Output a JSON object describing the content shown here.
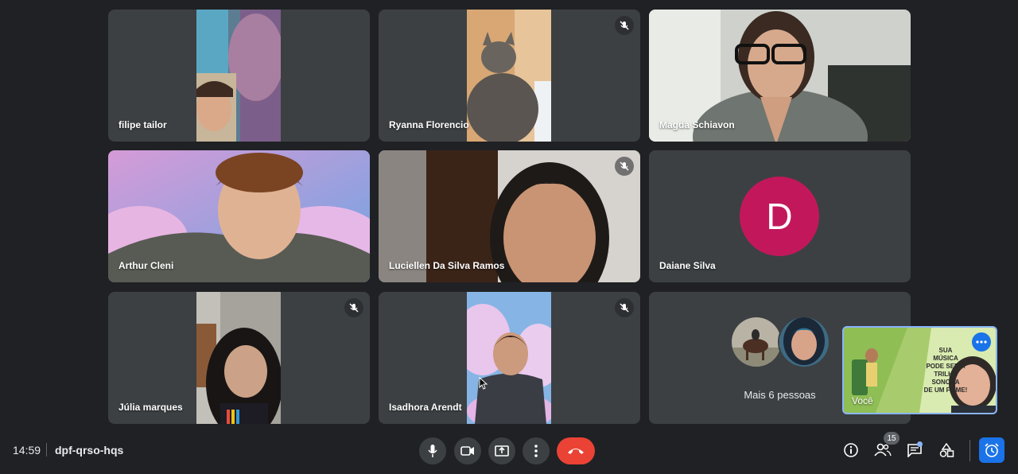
{
  "participants": [
    {
      "name": "filipe tailor",
      "muted": false
    },
    {
      "name": "Ryanna Florencio",
      "muted": true
    },
    {
      "name": "Magda Schiavon",
      "muted": false
    },
    {
      "name": "Arthur Cleni",
      "muted": false
    },
    {
      "name": "Luciellen Da Silva Ramos",
      "muted": true
    },
    {
      "name": "Daiane Silva",
      "muted": false,
      "avatar_letter": "D",
      "avatar_color": "#c2185b"
    },
    {
      "name": "Júlia marques",
      "muted": true
    },
    {
      "name": "Isadhora Arendt",
      "muted": true
    }
  ],
  "overflow_tile": {
    "label": "Mais 6 pessoas"
  },
  "self_view": {
    "name": "Você",
    "slide_text": [
      "SUA",
      "MÚSICA",
      "PODE SER A",
      "TRILHA SONORA",
      "DE UM FILME!"
    ]
  },
  "bottom_bar": {
    "time": "14:59",
    "meeting_code": "dpf-qrso-hqs",
    "controls": [
      "mic-icon",
      "camera-icon",
      "present-icon",
      "more-vert-icon",
      "hangup-icon"
    ],
    "right_controls": [
      "info-icon",
      "people-icon",
      "chat-icon",
      "activities-icon",
      "alarm-icon"
    ],
    "people_count": "15"
  },
  "colors": {
    "background": "#202124",
    "tile": "#3c4043",
    "hangup": "#ea4335",
    "accent": "#1a73e8",
    "highlight_border": "#8ab4f8"
  }
}
